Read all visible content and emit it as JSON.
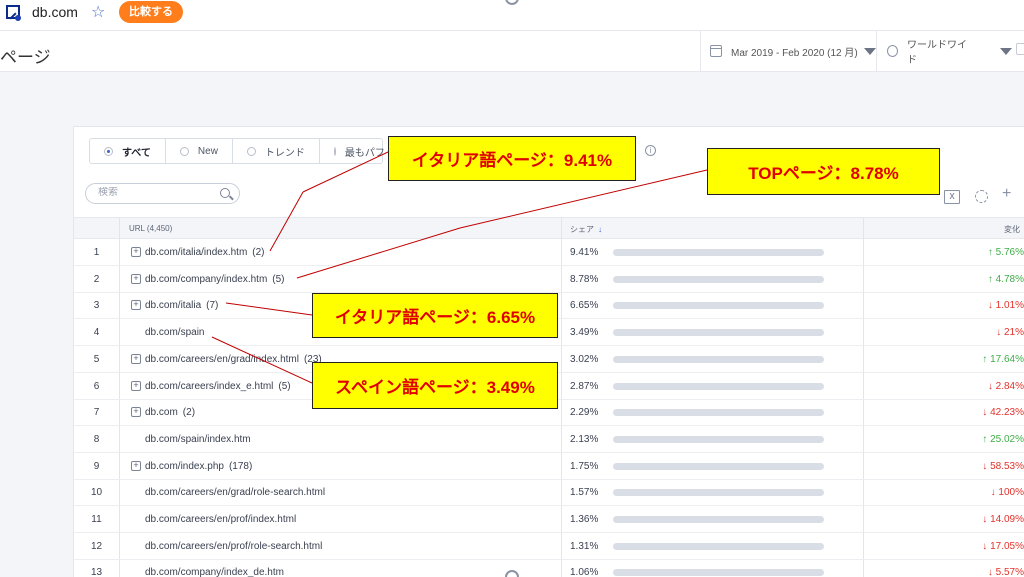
{
  "header": {
    "site": "db.com",
    "compare_button": "比較する"
  },
  "title_bar": {
    "page_title": "ページ",
    "date_range": "Mar 2019 - Feb 2020 (12 月)",
    "region": "ワールドワイド"
  },
  "filters": [
    {
      "label": "すべて",
      "selected": true
    },
    {
      "label": "New",
      "selected": false
    },
    {
      "label": "トレンド",
      "selected": false
    },
    {
      "label": "最もパフ",
      "selected": false
    }
  ],
  "search": {
    "placeholder": "検索"
  },
  "table": {
    "headers": {
      "url": "URL (4,450)",
      "share": "シェア",
      "share_sort_icon": "↓",
      "change": "変化"
    },
    "rows": [
      {
        "num": "1",
        "url": "db.com/italia/index.htm",
        "count": "(2)",
        "expandable": true,
        "share": "9.41%",
        "share_fraction": 0.0941,
        "change": "↑ 5.76%",
        "direction": "up"
      },
      {
        "num": "2",
        "url": "db.com/company/index.htm",
        "count": "(5)",
        "expandable": true,
        "share": "8.78%",
        "share_fraction": 0.0878,
        "change": "↑ 4.78%",
        "direction": "up"
      },
      {
        "num": "3",
        "url": "db.com/italia",
        "count": "(7)",
        "expandable": true,
        "share": "6.65%",
        "share_fraction": 0.0665,
        "change": "↓ 1.01%",
        "direction": "down"
      },
      {
        "num": "4",
        "url": "db.com/spain",
        "count": "",
        "expandable": false,
        "share": "3.49%",
        "share_fraction": 0.0349,
        "change": "↓ 21%",
        "direction": "down"
      },
      {
        "num": "5",
        "url": "db.com/careers/en/grad/index.html",
        "count": "(23)",
        "expandable": true,
        "share": "3.02%",
        "share_fraction": 0.0302,
        "change": "↑ 17.64%",
        "direction": "up"
      },
      {
        "num": "6",
        "url": "db.com/careers/index_e.html",
        "count": "(5)",
        "expandable": true,
        "share": "2.87%",
        "share_fraction": 0.0287,
        "change": "↓ 2.84%",
        "direction": "down"
      },
      {
        "num": "7",
        "url": "db.com",
        "count": "(2)",
        "expandable": true,
        "share": "2.29%",
        "share_fraction": 0.0229,
        "change": "↓ 42.23%",
        "direction": "down"
      },
      {
        "num": "8",
        "url": "db.com/spain/index.htm",
        "count": "",
        "expandable": false,
        "share": "2.13%",
        "share_fraction": 0.0213,
        "change": "↑ 25.02%",
        "direction": "up"
      },
      {
        "num": "9",
        "url": "db.com/index.php",
        "count": "(178)",
        "expandable": true,
        "share": "1.75%",
        "share_fraction": 0.0175,
        "change": "↓ 58.53%",
        "direction": "down"
      },
      {
        "num": "10",
        "url": "db.com/careers/en/grad/role-search.html",
        "count": "",
        "expandable": false,
        "share": "1.57%",
        "share_fraction": 0.0157,
        "change": "↓ 100%",
        "direction": "down"
      },
      {
        "num": "11",
        "url": "db.com/careers/en/prof/index.html",
        "count": "",
        "expandable": false,
        "share": "1.36%",
        "share_fraction": 0.0136,
        "change": "↓ 14.09%",
        "direction": "down"
      },
      {
        "num": "12",
        "url": "db.com/careers/en/prof/role-search.html",
        "count": "",
        "expandable": false,
        "share": "1.31%",
        "share_fraction": 0.0131,
        "change": "↓ 17.05%",
        "direction": "down"
      },
      {
        "num": "13",
        "url": "db.com/company/index_de.htm",
        "count": "",
        "expandable": false,
        "share": "1.06%",
        "share_fraction": 0.0106,
        "change": "↓ 5.57%",
        "direction": "down"
      }
    ]
  },
  "callouts": {
    "italia_1": "イタリア語ページ：9.41%",
    "top": "TOPページ：8.78%",
    "italia_2": "イタリア語ページ：6.65%",
    "spain": "スペイン語ページ：3.49%"
  },
  "colors": {
    "accent": "#3266d5",
    "compare_button": "#ff7e1b",
    "up": "#3fae49",
    "down": "#e4322b",
    "callout_bg": "#ffff00",
    "callout_text": "#e00000"
  }
}
